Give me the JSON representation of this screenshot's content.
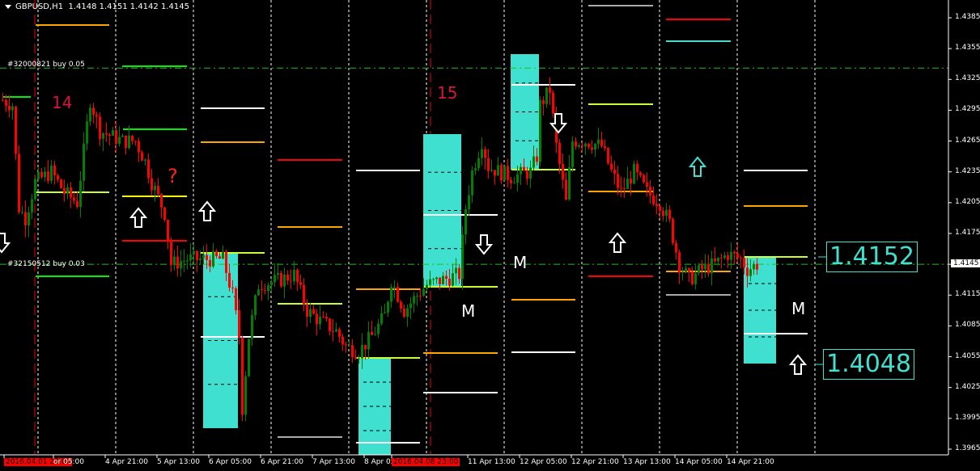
{
  "header": {
    "symbol": "GBPUSD,H1",
    "ohlc": "1.4148 1.4151 1.4142 1.4145"
  },
  "orders": [
    {
      "label": "#32000821 buy 0.05",
      "price": 1.4336
    },
    {
      "label": "#32150512 buy 0.03",
      "price": 1.4145
    }
  ],
  "annotations": {
    "day14": "14",
    "day15": "15",
    "question": "?",
    "m1": "M",
    "m2": "M",
    "m3": "M"
  },
  "price_boxes": {
    "upper": "1.4152",
    "lower": "1.4048"
  },
  "current_price": "1.4145",
  "colors": {
    "background": "#000000",
    "bull": "#008000",
    "bear": "#ff0000",
    "zone": "#40e0d0",
    "grid": "#ffffff",
    "order_line": "#00c000"
  },
  "chart_data": {
    "type": "candlestick",
    "symbol": "GBPUSD",
    "timeframe": "H1",
    "y_ticks": [
      "1.4385",
      "1.4355",
      "1.4325",
      "1.4295",
      "1.4265",
      "1.4235",
      "1.4205",
      "1.4175",
      "1.4145",
      "1.4115",
      "1.4085",
      "1.4055",
      "1.4025",
      "1.3995",
      "1.3965"
    ],
    "ylim": [
      1.395,
      1.4405
    ],
    "x_labels": [
      "2016.04.01 23:00",
      "or 05:00",
      "4 Apr 21:00",
      "5 Apr 13:00",
      "6 Apr 05:00",
      "6 Apr 21:00",
      "7 Apr 13:00",
      "8 Apr 05:00",
      "2016.04.08 23:00",
      "11 Apr 13:00",
      "12 Apr 05:00",
      "12 Apr 21:00",
      "13 Apr 13:00",
      "14 Apr 05:00",
      "14 Apr 21:00"
    ],
    "close_path": [
      [
        0,
        1.4305
      ],
      [
        3,
        1.43
      ],
      [
        5,
        1.42
      ],
      [
        7,
        1.419
      ],
      [
        10,
        1.4225
      ],
      [
        15,
        1.4235
      ],
      [
        19,
        1.4215
      ],
      [
        23,
        1.4205
      ],
      [
        25,
        1.4255
      ],
      [
        27,
        1.4305
      ],
      [
        30,
        1.4275
      ],
      [
        37,
        1.4265
      ],
      [
        41,
        1.4265
      ],
      [
        44,
        1.4245
      ],
      [
        46,
        1.4225
      ],
      [
        50,
        1.4195
      ],
      [
        52,
        1.4145
      ],
      [
        57,
        1.415
      ],
      [
        68,
        1.415
      ],
      [
        71,
        1.4115
      ],
      [
        73,
        1.4075
      ],
      [
        74,
        1.4005
      ],
      [
        76,
        1.4075
      ],
      [
        79,
        1.4125
      ],
      [
        86,
        1.413
      ],
      [
        90,
        1.4135
      ],
      [
        94,
        1.41
      ],
      [
        98,
        1.409
      ],
      [
        103,
        1.408
      ],
      [
        106,
        1.4065
      ],
      [
        110,
        1.406
      ],
      [
        114,
        1.4075
      ],
      [
        118,
        1.4095
      ],
      [
        120,
        1.413
      ],
      [
        124,
        1.41
      ],
      [
        128,
        1.4115
      ],
      [
        131,
        1.4125
      ],
      [
        136,
        1.413
      ],
      [
        141,
        1.4135
      ],
      [
        143,
        1.42
      ],
      [
        145,
        1.4235
      ],
      [
        148,
        1.4265
      ],
      [
        150,
        1.424
      ],
      [
        157,
        1.423
      ],
      [
        163,
        1.4235
      ],
      [
        165,
        1.425
      ],
      [
        166,
        1.43
      ],
      [
        169,
        1.4315
      ],
      [
        171,
        1.426
      ],
      [
        174,
        1.4205
      ],
      [
        176,
        1.4265
      ],
      [
        180,
        1.4265
      ],
      [
        185,
        1.426
      ],
      [
        188,
        1.4235
      ],
      [
        191,
        1.4215
      ],
      [
        195,
        1.4235
      ],
      [
        199,
        1.4215
      ],
      [
        203,
        1.4205
      ],
      [
        206,
        1.4185
      ],
      [
        209,
        1.4145
      ],
      [
        212,
        1.413
      ],
      [
        216,
        1.414
      ],
      [
        220,
        1.4145
      ],
      [
        224,
        1.4155
      ],
      [
        228,
        1.415
      ],
      [
        230,
        1.414
      ],
      [
        233,
        1.4145
      ]
    ]
  }
}
